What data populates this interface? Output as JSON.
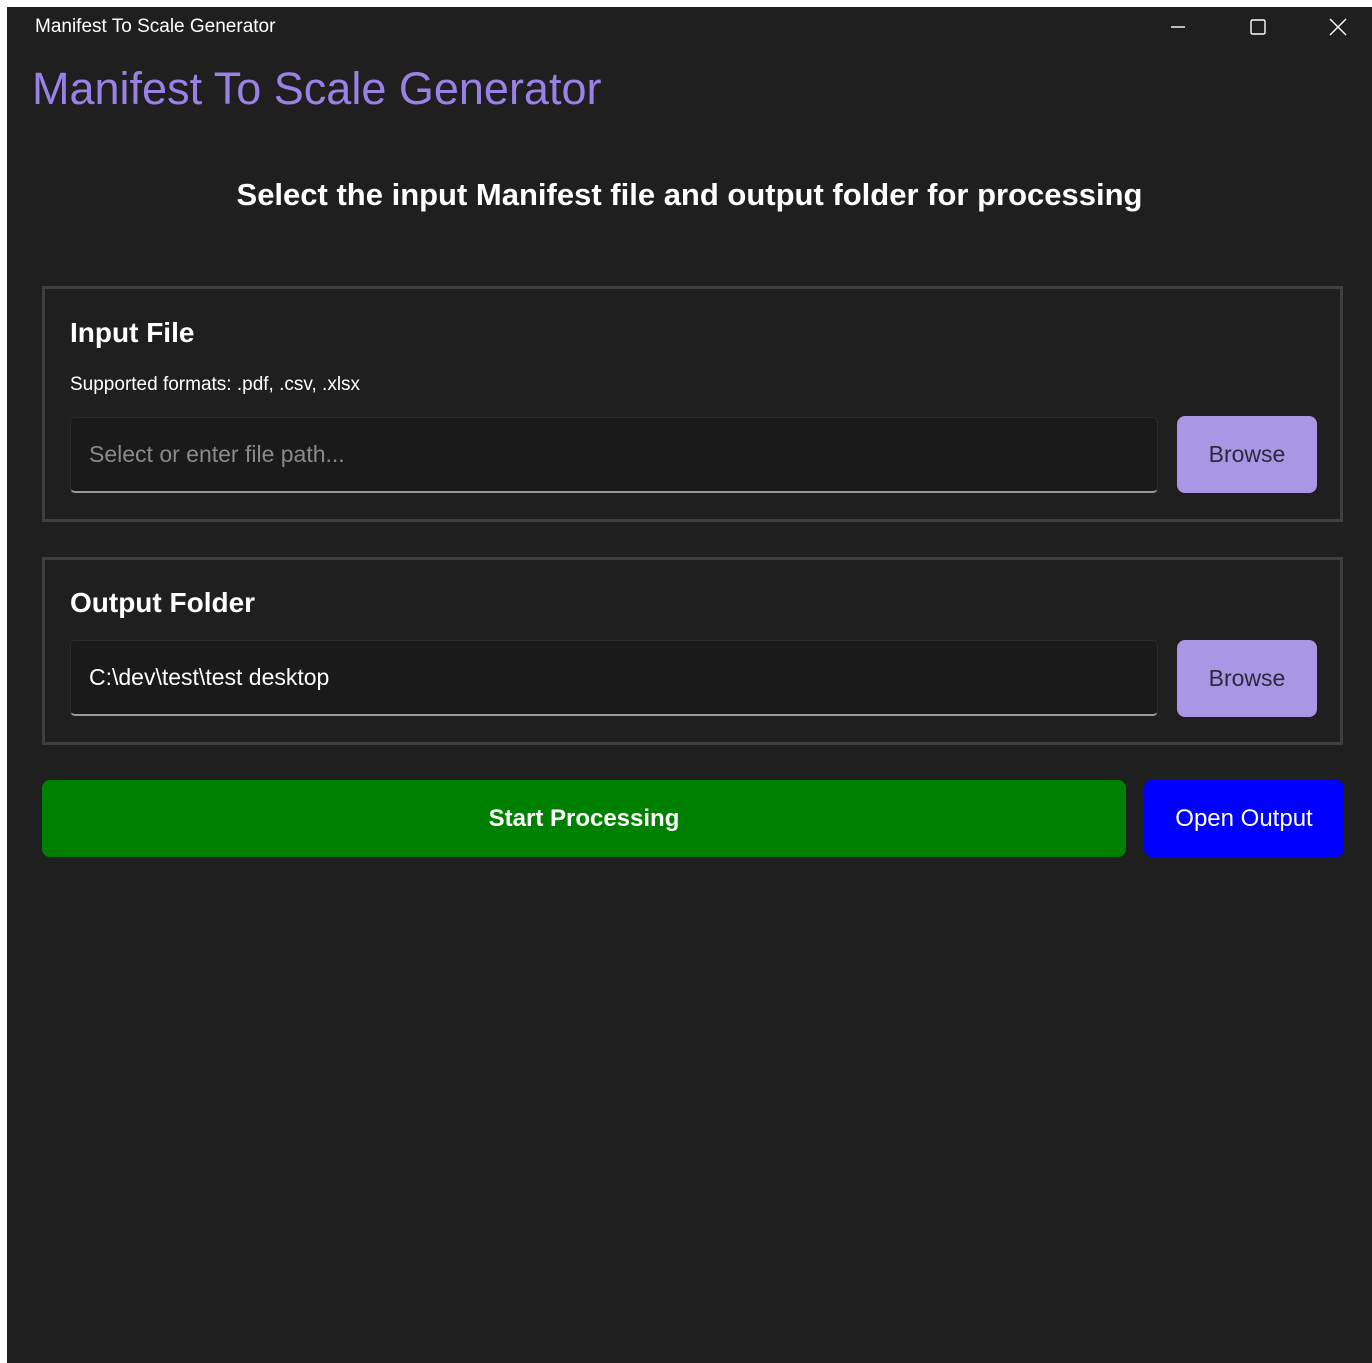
{
  "window": {
    "title": "Manifest To Scale Generator"
  },
  "app": {
    "heading": "Manifest To Scale Generator",
    "instruction": "Select the input Manifest file and output folder for processing",
    "accent_color": "#9a81e6"
  },
  "input_panel": {
    "title": "Input File",
    "subtitle": "Supported formats: .pdf, .csv, .xlsx",
    "field_value": "",
    "field_placeholder": "Select or enter file path...",
    "browse_label": "Browse"
  },
  "output_panel": {
    "title": "Output Folder",
    "field_value": "C:\\dev\\test\\test desktop",
    "field_placeholder": "",
    "browse_label": "Browse"
  },
  "actions": {
    "start_label": "Start Processing",
    "start_color": "#008000",
    "open_label": "Open Output",
    "open_color": "#0000ff"
  },
  "icons": {
    "minimize": "minimize-icon",
    "maximize": "maximize-icon",
    "close": "close-icon"
  }
}
